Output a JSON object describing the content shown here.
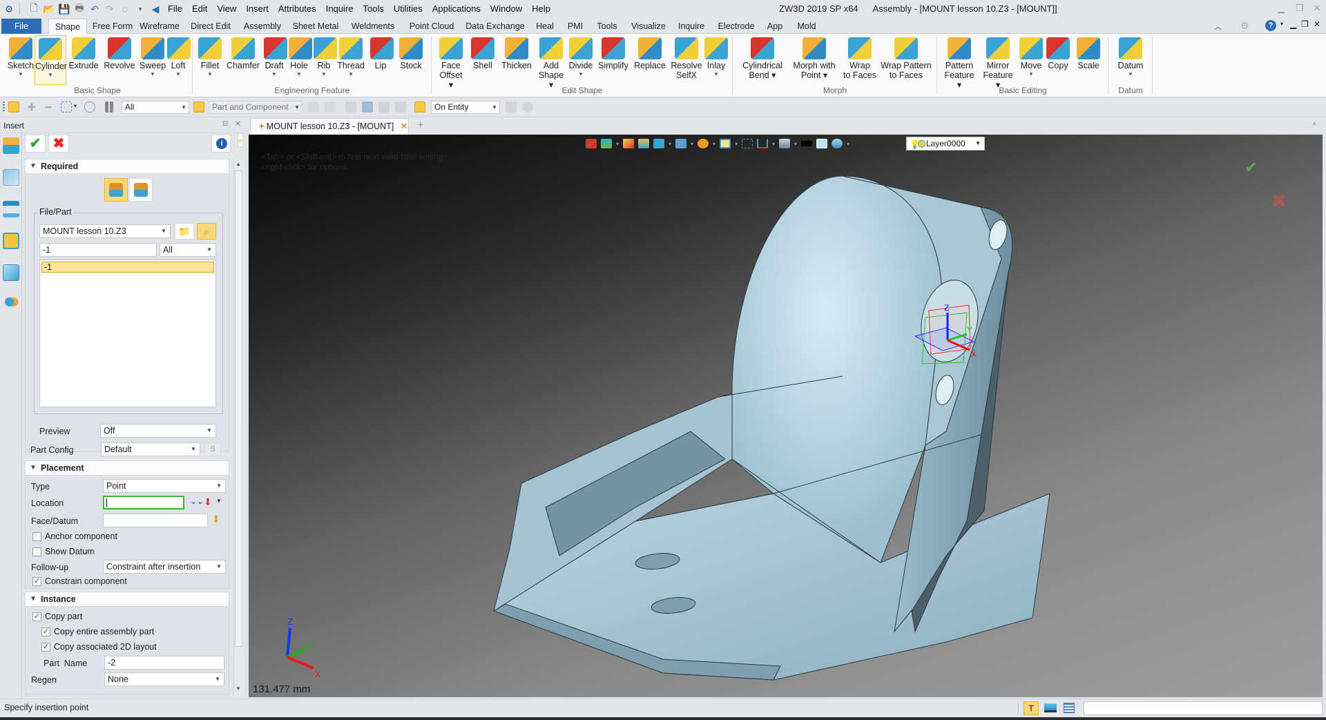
{
  "app": {
    "title": "ZW3D 2019 SP x64",
    "document_title": "Assembly - [MOUNT lesson 10.Z3 - [MOUNT]]"
  },
  "quick_access": [
    "new-file-icon",
    "open-file-icon",
    "save-icon",
    "print-icon",
    "undo-icon",
    "redo-icon",
    "sync-icon"
  ],
  "menu": [
    "File",
    "Edit",
    "View",
    "Insert",
    "Attributes",
    "Inquire",
    "Tools",
    "Utilities",
    "Applications",
    "Window",
    "Help"
  ],
  "ribbon_tabs": [
    "File",
    "Shape",
    "Free Form",
    "Wireframe",
    "Direct Edit",
    "Assembly",
    "Sheet Metal",
    "Weldments",
    "Point Cloud",
    "Data Exchange",
    "Heal",
    "PMI",
    "Tools",
    "Visualize",
    "Inquire",
    "Electrode",
    "App",
    "Mold"
  ],
  "active_ribbon_tab": "Shape",
  "ribbon_groups": [
    {
      "label": "Basic Shape",
      "buttons": [
        {
          "label": "Sketch",
          "dropdown": true
        },
        {
          "label": "Cylinder",
          "dropdown": true,
          "selected": true
        },
        {
          "label": "Extrude",
          "dropdown": false
        },
        {
          "label": "Revolve",
          "dropdown": false
        },
        {
          "label": "Sweep",
          "dropdown": true
        },
        {
          "label": "Loft",
          "dropdown": true
        }
      ]
    },
    {
      "label": "Engineering Feature",
      "buttons": [
        {
          "label": "Fillet",
          "dropdown": true
        },
        {
          "label": "Chamfer",
          "dropdown": false
        },
        {
          "label": "Draft",
          "dropdown": true
        },
        {
          "label": "Hole",
          "dropdown": true
        },
        {
          "label": "Rib",
          "dropdown": true
        },
        {
          "label": "Thread",
          "dropdown": true
        },
        {
          "label": "Lip",
          "dropdown": false
        },
        {
          "label": "Stock",
          "dropdown": false
        }
      ]
    },
    {
      "label": "Edit Shape",
      "buttons": [
        {
          "label": "Face Offset",
          "dropdown": true
        },
        {
          "label": "Shell",
          "dropdown": false
        },
        {
          "label": "Thicken",
          "dropdown": false
        },
        {
          "label": "Add Shape",
          "dropdown": true
        },
        {
          "label": "Divide",
          "dropdown": true
        },
        {
          "label": "Simplify",
          "dropdown": false
        },
        {
          "label": "Replace",
          "dropdown": false
        },
        {
          "label": "Resolve SelfX",
          "dropdown": false
        },
        {
          "label": "Inlay",
          "dropdown": true
        }
      ]
    },
    {
      "label": "Morph",
      "buttons": [
        {
          "label": "Cylindrical Bend",
          "dropdown": true
        },
        {
          "label": "Morph with Point",
          "dropdown": true
        },
        {
          "label": "Wrap to Faces",
          "dropdown": false
        },
        {
          "label": "Wrap Pattern to Faces",
          "dropdown": false
        }
      ]
    },
    {
      "label": "Basic Editing",
      "buttons": [
        {
          "label": "Pattern Feature",
          "dropdown": true
        },
        {
          "label": "Mirror Feature",
          "dropdown": true
        },
        {
          "label": "Move",
          "dropdown": true
        },
        {
          "label": "Copy",
          "dropdown": false
        },
        {
          "label": "Scale",
          "dropdown": false
        }
      ]
    },
    {
      "label": "Datum",
      "buttons": [
        {
          "label": "Datum",
          "dropdown": true
        }
      ]
    }
  ],
  "toolbar": {
    "filter_value": "All",
    "selection_scope": "Part and Component",
    "pick_mode": "On Entity"
  },
  "panel": {
    "title": "Insert",
    "required": {
      "header": "Required",
      "file_part_label": "File/Part",
      "file_value": "MOUNT lesson 10.Z3",
      "search_value": "-1",
      "filter_value": "All",
      "list_items": [
        "-1"
      ],
      "selected_item": "-1",
      "preview_label": "Preview",
      "preview_value": "Off",
      "part_config_label": "Part Config",
      "part_config_value": "Default",
      "s_button": "S"
    },
    "placement": {
      "header": "Placement",
      "type_label": "Type",
      "type_value": "Point",
      "location_label": "Location",
      "location_value": "",
      "face_datum_label": "Face/Datum",
      "face_datum_value": "",
      "anchor_label": "Anchor component",
      "anchor_checked": false,
      "show_datum_label": "Show Datum",
      "show_datum_checked": false,
      "followup_label": "Follow-up",
      "followup_value": "Constraint after insertion",
      "constrain_label": "Constrain component",
      "constrain_checked": true
    },
    "instance": {
      "header": "Instance",
      "copy_part_label": "Copy part",
      "copy_part_checked": true,
      "copy_assembly_label": "Copy entire assembly part",
      "copy_assembly_checked": true,
      "copy_2d_label": "Copy associated 2D layout",
      "copy_2d_checked": true,
      "part_name_label": "Part  Name",
      "part_name_value": "-2",
      "regen_label": "Regen",
      "regen_value": "None"
    }
  },
  "document_tab": {
    "label": "MOUNT lesson 10.Z3 - [MOUNT]"
  },
  "viewport": {
    "hint_lines": [
      "<Tab> or <Shift-roll> to find next valid filter setting.",
      "<right-click> for options."
    ],
    "layer": "Layer0000",
    "distance_readout": "131.477 mm",
    "triad_labels": {
      "x": "X",
      "y": "Y",
      "z": "Z"
    },
    "colors": {
      "model": "#a9c6d3",
      "accept": "#5cb85c",
      "cancel": "#d9534f"
    }
  },
  "status": {
    "message": "Specify insertion point",
    "command_input": ""
  }
}
